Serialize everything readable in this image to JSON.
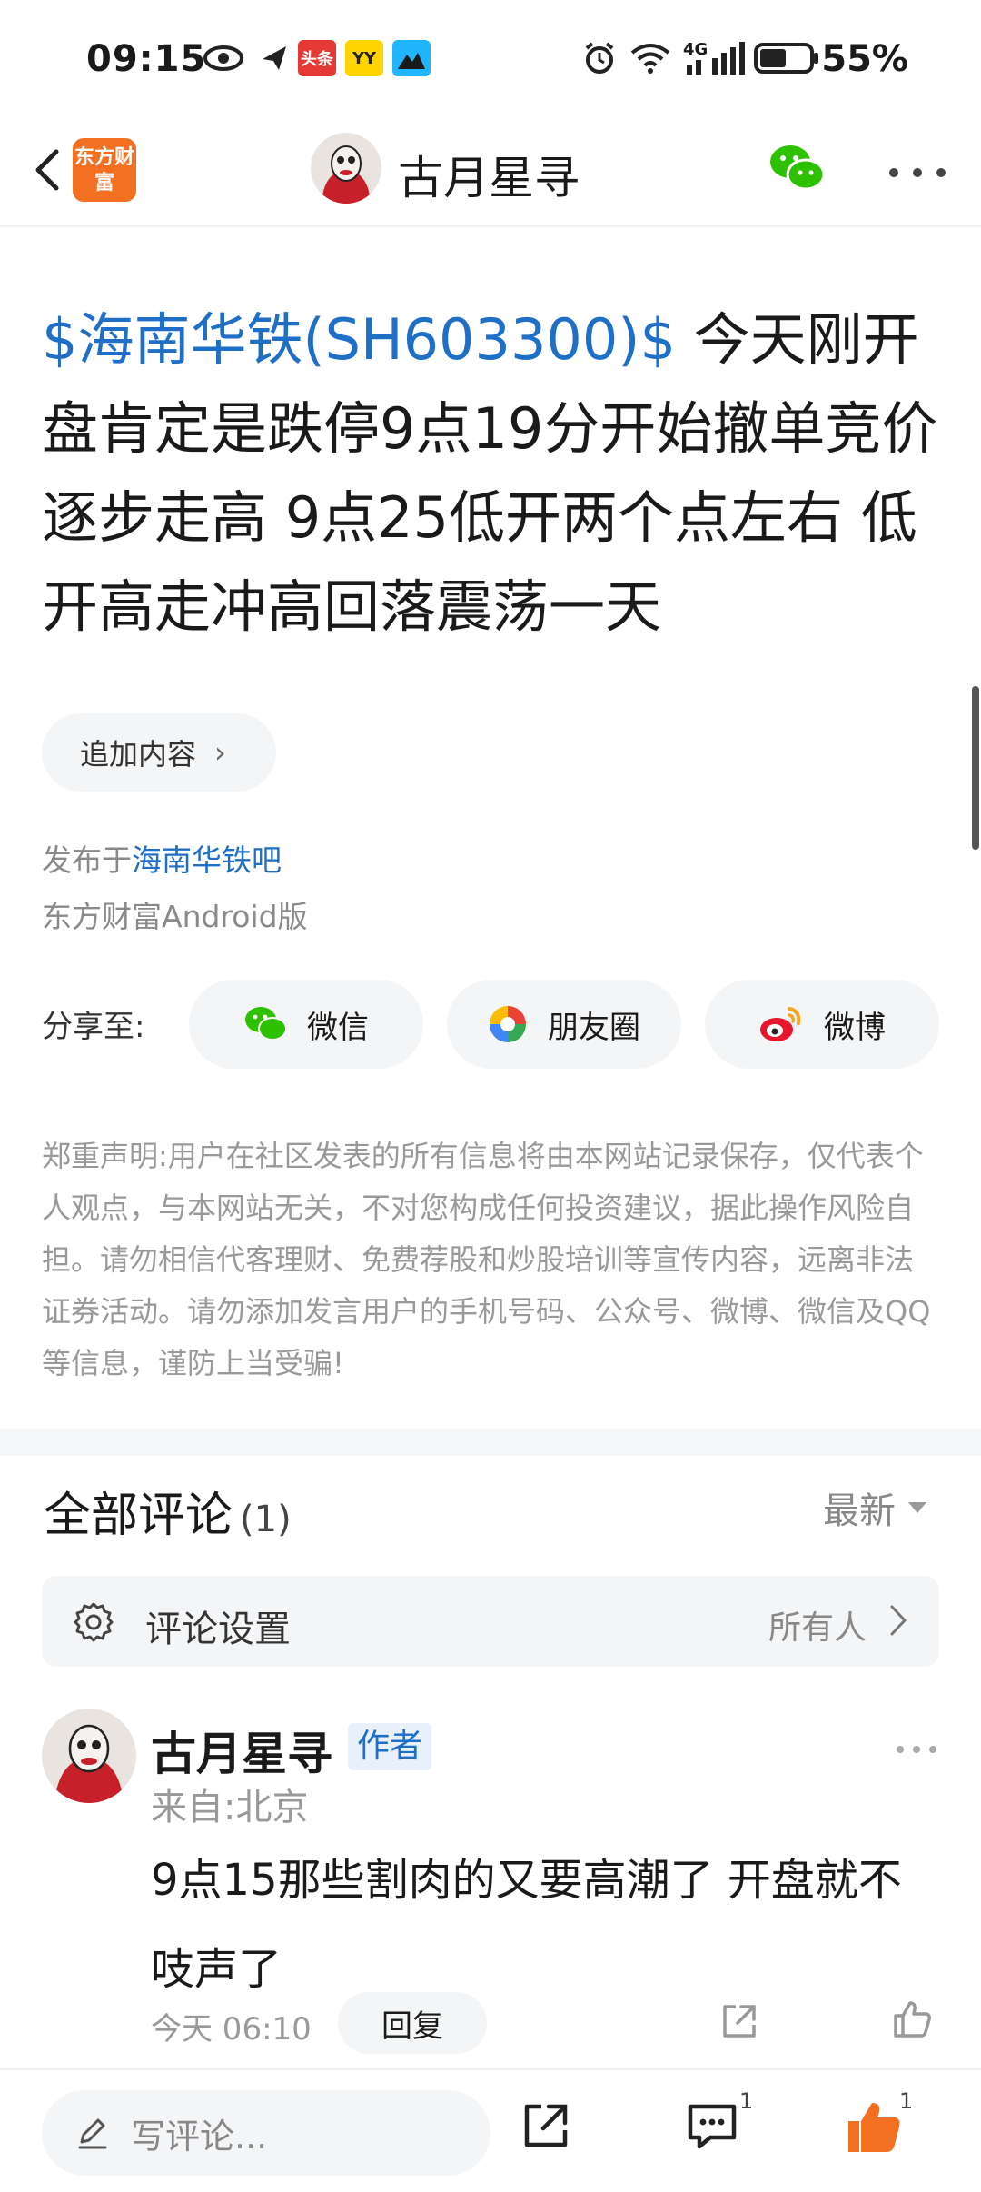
{
  "status_bar": {
    "time": "09:15",
    "battery_percent": "55%",
    "network": "4G",
    "battery_level": 0.55,
    "notification_badges": [
      "头条",
      "YY"
    ]
  },
  "nav": {
    "app_logo_text": "东方财富",
    "title": "古月星寻"
  },
  "post": {
    "stock_tag": "$海南华铁(SH603300)$",
    "body": "  今天刚开盘肯定是跌停9点19分开始撤单竞价逐步走高 9点25低开两个点左右  低开高走冲高回落震荡一天",
    "append_button": "追加内容",
    "published_prefix": "发布于",
    "published_forum": "海南华铁吧",
    "client": "东方财富Android版"
  },
  "share": {
    "label": "分享至:",
    "wechat": "微信",
    "moments": "朋友圈",
    "weibo": "微博"
  },
  "disclaimer": "郑重声明:用户在社区发表的所有信息将由本网站记录保存，仅代表个人观点，与本网站无关，不对您构成任何投资建议，据此操作风险自担。请勿相信代客理财、免费荐股和炒股培训等宣传内容，远离非法证券活动。请勿添加发言用户的手机号码、公众号、微博、微信及QQ等信息，谨防上当受骗!",
  "comments": {
    "title": "全部评论",
    "count": "(1)",
    "sort": "最新",
    "settings_label": "评论设置",
    "settings_value": "所有人",
    "items": [
      {
        "author": "古月星寻",
        "badge": "作者",
        "location": "来自:北京",
        "text": "9点15那些割肉的又要高潮了  开盘就不吱声了",
        "time": "今天 06:10",
        "reply_label": "回复"
      }
    ]
  },
  "bottom_bar": {
    "input_placeholder": "写评论...",
    "comment_count": "1",
    "like_count": "1"
  },
  "colors": {
    "link_blue": "#1f6fc6",
    "like_orange": "#f36f21",
    "wechat_green": "#2dc100",
    "brand_orange": "#f36f21"
  }
}
